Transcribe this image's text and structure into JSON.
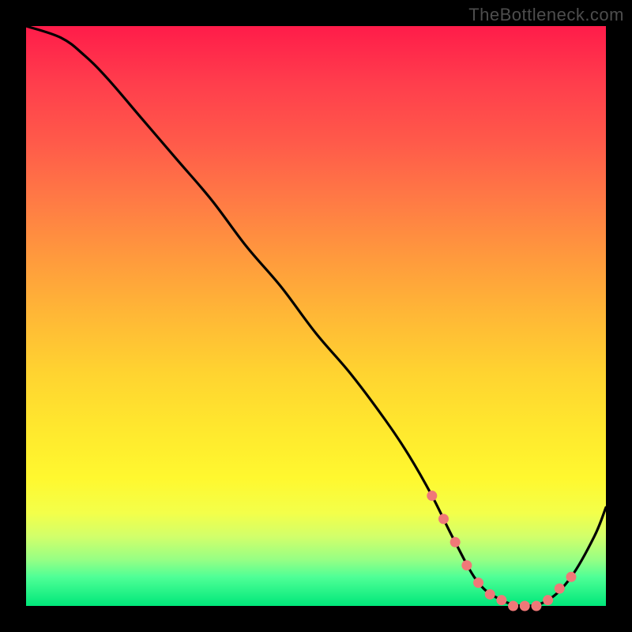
{
  "watermark": "TheBottleneck.com",
  "colors": {
    "frame_bg": "#000000",
    "gradient_top": "#ff1c4a",
    "gradient_bottom": "#00e77a",
    "curve_stroke": "#000000",
    "marker_fill": "#f07878",
    "watermark_text": "#4d4d4d"
  },
  "chart_data": {
    "type": "line",
    "title": "",
    "xlabel": "",
    "ylabel": "",
    "xlim": [
      0,
      100
    ],
    "ylim": [
      0,
      100
    ],
    "series": [
      {
        "name": "bottleneck-curve",
        "x": [
          0,
          6,
          10,
          14,
          20,
          26,
          32,
          38,
          44,
          50,
          56,
          62,
          66,
          70,
          74,
          78,
          82,
          86,
          90,
          94,
          98,
          100
        ],
        "values": [
          100,
          98,
          95,
          91,
          84,
          77,
          70,
          62,
          55,
          47,
          40,
          32,
          26,
          19,
          11,
          4,
          1,
          0,
          1,
          5,
          12,
          17
        ]
      }
    ],
    "markers": {
      "name": "highlighted-points",
      "x": [
        70,
        72,
        74,
        76,
        78,
        80,
        82,
        84,
        86,
        88,
        90,
        92,
        94
      ],
      "values": [
        19,
        15,
        11,
        7,
        4,
        2,
        1,
        0,
        0,
        0,
        1,
        3,
        5
      ]
    }
  }
}
